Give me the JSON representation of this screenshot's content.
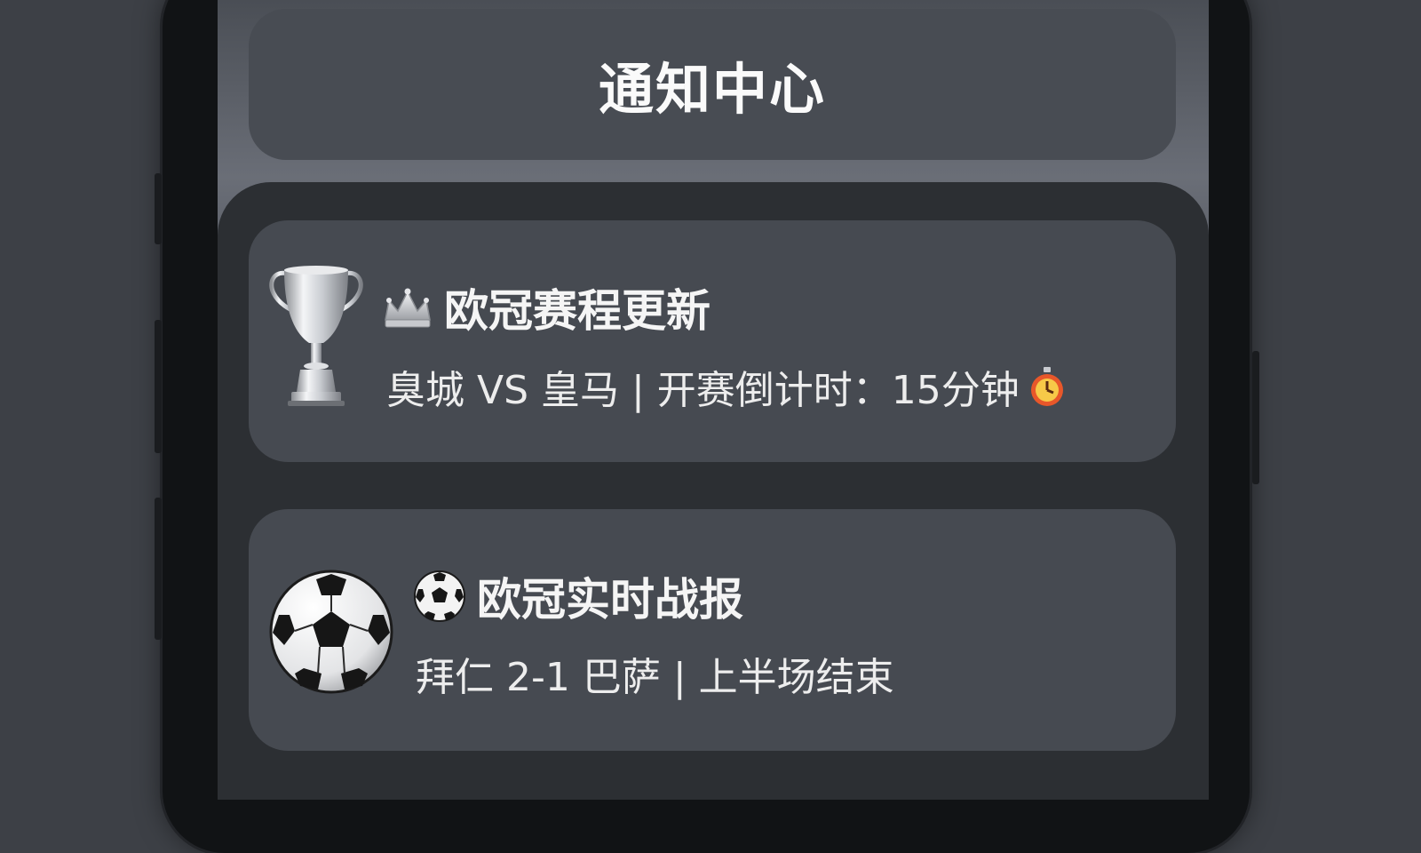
{
  "header": {
    "title": "通知中心"
  },
  "notifications": [
    {
      "icon": "trophy-icon",
      "title_icon": "crown-icon",
      "title": "欧冠赛程更新",
      "body": "臭城 VS 皇马 | 开赛倒计时：15分钟",
      "trailing_icon": "stopwatch-icon"
    },
    {
      "icon": "soccer-ball-icon",
      "title_icon": "soccer-ball-icon",
      "title": "欧冠实时战报",
      "body": "拜仁 2-1 巴萨 | 上半场结束"
    }
  ],
  "colors": {
    "background": "#3d4046",
    "card": "#464a51",
    "panel": "#2c2f33",
    "text": "#f2f2f2",
    "accent_timer": "#e8572a"
  }
}
